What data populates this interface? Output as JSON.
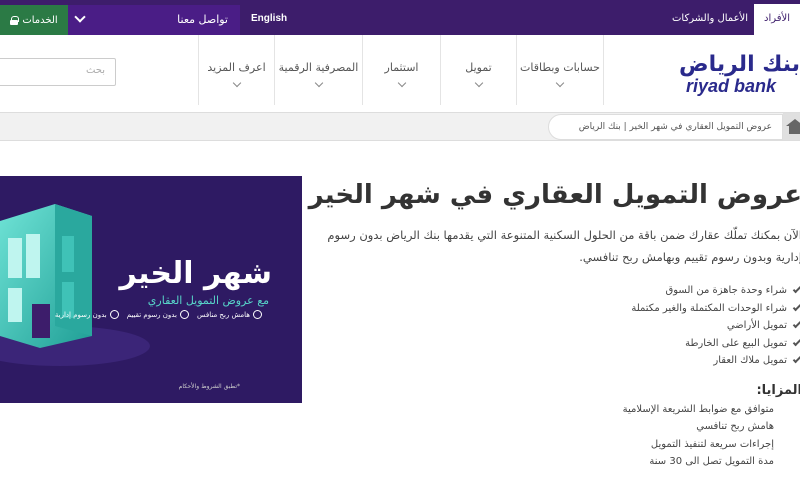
{
  "topbar": {
    "services_label": "الخدمات",
    "contact_label": "تواصل معنا",
    "language_label": "English",
    "business_label": "الأعمال والشركات",
    "individuals_label": "الأفراد"
  },
  "header": {
    "logo_ar": "بنك الرياض",
    "logo_en": "riyad bank",
    "search_placeholder": "بحث",
    "nav": [
      {
        "label": "حسابات وبطاقات"
      },
      {
        "label": "تمويل"
      },
      {
        "label": "استثمار"
      },
      {
        "label": "المصرفية الرقمية"
      },
      {
        "label": "اعرف المزيد"
      }
    ]
  },
  "breadcrumb": {
    "text": "عروض التمويل العقاري في شهر الخير | بنك الرياض"
  },
  "banner": {
    "title": "شهر الخير",
    "subtitle": "مع عروض التمويل العقاري",
    "badges": [
      {
        "text": "بدون رسوم إدارية"
      },
      {
        "text": "بدون رسوم تقييم"
      },
      {
        "text": "هامش ربح منافس"
      }
    ],
    "terms": "*تطبق الشروط والأحكام",
    "colors": {
      "background": "#2e1a63",
      "accent": "#58d5c9"
    }
  },
  "article": {
    "title": "عروض التمويل العقاري في شهر الخير",
    "intro": "الآن بمكنك تملّك عقارك ضمن باقة من الحلول السكنية المتنوعة التي يقدمها بنك الرياض بدون رسوم إدارية وبدون رسوم تقييم وبهامش ربح تنافسي.",
    "checklist": [
      "شراء وحدة جاهزة من السوق",
      "شراء الوحدات المكتملة والغير مكتملة",
      "تمويل الأراضي",
      "تمويل البيع على الخارطة",
      "تمويل ملاك العقار"
    ],
    "features_title": "المزايا:",
    "features": [
      "متوافق مع ضوابط الشريعة الإسلامية",
      "هامش ربح تنافسي",
      "إجراءات سريعة لتنفيذ التمويل",
      "مدة التمويل تصل الى 30 سنة"
    ]
  },
  "colors": {
    "topbar": "#3d1d6b",
    "services_button": "#2b7a45",
    "logo": "#2a2a8c"
  }
}
